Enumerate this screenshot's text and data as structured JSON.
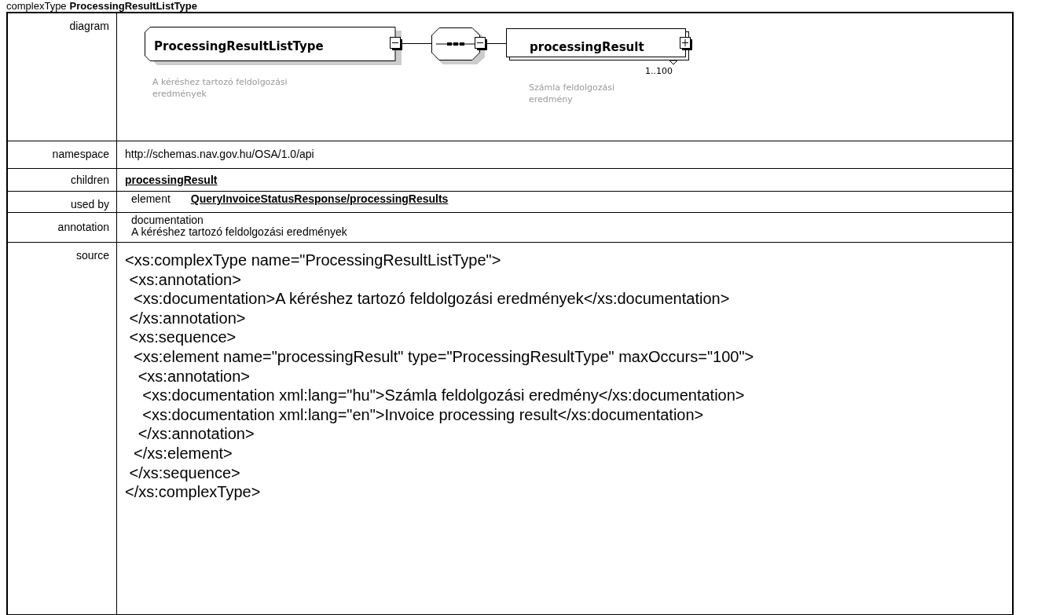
{
  "heading": {
    "kind": "complexType",
    "name": "ProcessingResultListType"
  },
  "diagram": {
    "label": "diagram",
    "type_node": {
      "name": "ProcessingResultListType",
      "description": "A kéréshez tartozó feldolgozási eredmények",
      "expanded": true
    },
    "compositor": {
      "kind": "sequence",
      "expanded": true
    },
    "child_node": {
      "name": "processingResult",
      "occurs": "1..100",
      "description": "Számla feldolgozási eredmény",
      "expanded": false
    }
  },
  "namespace": {
    "label": "namespace",
    "value": "http://schemas.nav.gov.hu/OSA/1.0/api"
  },
  "children": {
    "label": "children",
    "links": [
      "processingResult"
    ]
  },
  "used_by": {
    "label": "used by",
    "kind": "element",
    "link": "QueryInvoiceStatusResponse/processingResults"
  },
  "annotation": {
    "label": "annotation",
    "kind": "documentation",
    "text": "A kéréshez tartozó feldolgozási eredmények"
  },
  "source": {
    "label": "source",
    "lines": [
      "<xs:complexType name=\"ProcessingResultListType\">",
      " <xs:annotation>",
      "  <xs:documentation>A kéréshez tartozó feldolgozási eredmények</xs:documentation>",
      " </xs:annotation>",
      " <xs:sequence>",
      "  <xs:element name=\"processingResult\" type=\"ProcessingResultType\" maxOccurs=\"100\">",
      "   <xs:annotation>",
      "    <xs:documentation xml:lang=\"hu\">Számla feldolgozási eredmény</xs:documentation>",
      "    <xs:documentation xml:lang=\"en\">Invoice processing result</xs:documentation>",
      "   </xs:annotation>",
      "  </xs:element>",
      " </xs:sequence>",
      "</xs:complexType>"
    ]
  }
}
